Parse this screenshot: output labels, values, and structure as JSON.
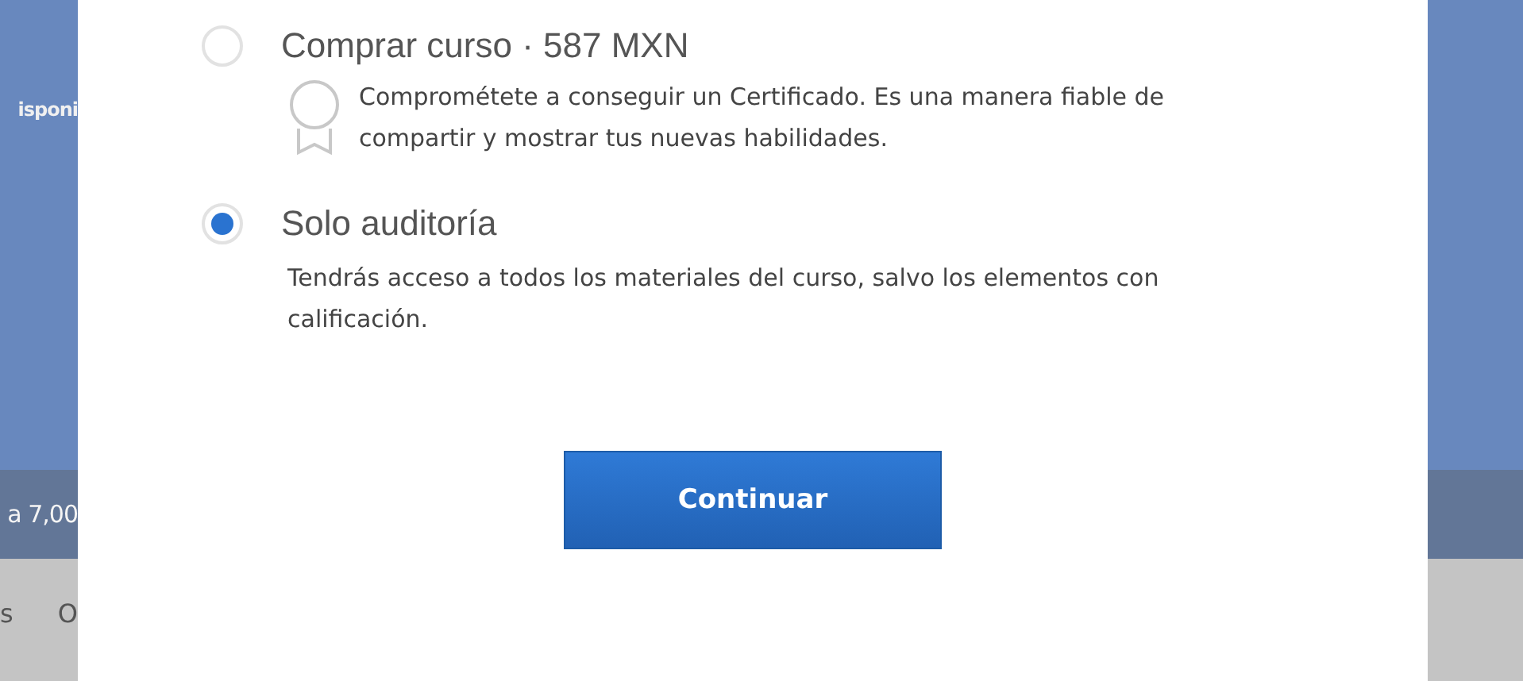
{
  "background": {
    "banner_text": "isponi",
    "band_text": "a 7,00",
    "nav_items": [
      "s",
      "O"
    ]
  },
  "options": [
    {
      "title": "Comprar curso · 587 MXN",
      "selected": false,
      "kind": "certificate",
      "description": "Comprométete a conseguir un Certificado. Es una manera fiable de compartir y mostrar tus nuevas habilidades."
    },
    {
      "title": "Solo auditoría",
      "selected": true,
      "kind": "plain",
      "description": "Tendrás acceso a todos los materiales del curso, salvo los elementos con calificación."
    }
  ],
  "button": "Continuar"
}
